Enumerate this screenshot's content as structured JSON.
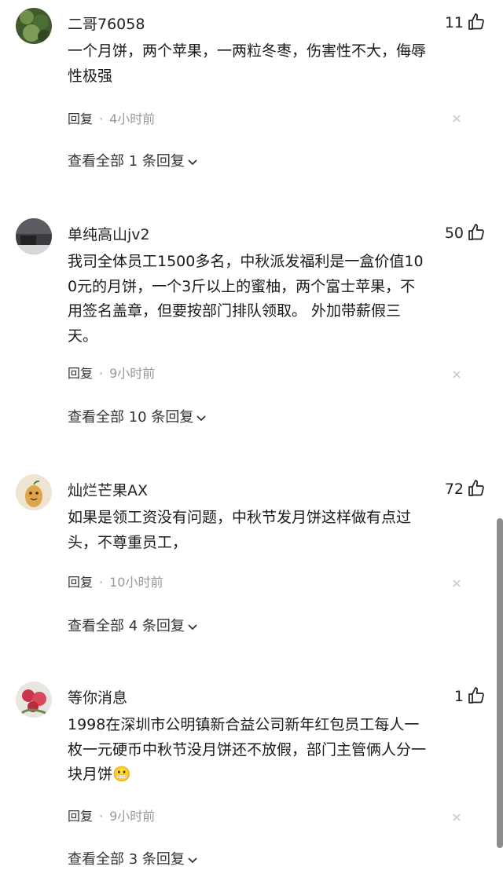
{
  "comments": [
    {
      "username": "二哥76058",
      "likes": "11",
      "lines": [
        "一个月饼，两个苹果，一两粒冬枣，伤害性不大，侮辱",
        "性极强"
      ],
      "reply_label": "回复",
      "time": "4小时前",
      "view_replies": "查看全部 1 条回复",
      "avatar_icon": "green-foliage-avatar"
    },
    {
      "username": "单纯高山jv2",
      "likes": "50",
      "lines": [
        "我司全体员工1500多名，中秋派发福利是一盒价值10",
        "0元的月饼，一个3斤以上的蜜柚，两个富士苹果，不",
        "用签名盖章，但要按部门排队领取。 外加带薪假三",
        "天。"
      ],
      "reply_label": "回复",
      "time": "9小时前",
      "view_replies": "查看全部 10 条回复",
      "avatar_icon": "dark-room-avatar"
    },
    {
      "username": "灿烂芒果AX",
      "likes": "72",
      "lines": [
        "如果是领工资没有问题，中秋节发月饼这样做有点过",
        "头，不尊重员工，"
      ],
      "reply_label": "回复",
      "time": "10小时前",
      "view_replies": "查看全部 4 条回复",
      "avatar_icon": "cartoon-mango-avatar"
    },
    {
      "username": "等你消息",
      "likes": "1",
      "lines": [
        "1998在深圳市公明镇新合益公司新年红包员工每人一",
        "枚一元硬币中秋节没月饼还不放假，部门主管俩人分一",
        "块月饼😬"
      ],
      "reply_label": "回复",
      "time": "9小时前",
      "view_replies": "查看全部 3 条回复",
      "avatar_icon": "red-flower-avatar"
    }
  ]
}
